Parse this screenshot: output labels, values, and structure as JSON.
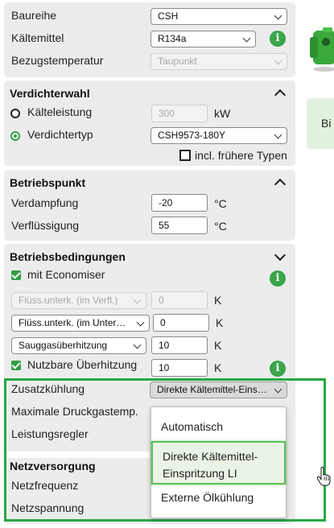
{
  "top": {
    "baureihe": {
      "label": "Baureihe",
      "value": "CSH"
    },
    "kaeltemittel": {
      "label": "Kältemittel",
      "value": "R134a"
    },
    "bezugstemperatur": {
      "label": "Bezugstemperatur",
      "value": "Taupunkt"
    }
  },
  "verdichterwahl": {
    "title": "Verdichterwahl",
    "kaelteleistung": {
      "label": "Kälteleistung",
      "value": "300",
      "unit": "kW"
    },
    "verdichtertyp": {
      "label": "Verdichtertyp",
      "value": "CSH9573-180Y"
    },
    "fruehere_typen": "incl. frühere Typen"
  },
  "betriebspunkt": {
    "title": "Betriebspunkt",
    "verdampfung": {
      "label": "Verdampfung",
      "value": "-20",
      "unit": "°C"
    },
    "verfluessigung": {
      "label": "Verflüssigung",
      "value": "55",
      "unit": "°C"
    }
  },
  "betriebsbedingungen": {
    "title": "Betriebsbedingungen",
    "economiser": "mit Economiser",
    "fluess_verfl": {
      "select": "Flüss.unterk. (im Verfl.)",
      "value": "0",
      "unit": "K"
    },
    "fluess_unter": {
      "select": "Flüss.unterk. (im Unter…",
      "value": "0",
      "unit": "K"
    },
    "sauggas": {
      "select": "Sauggasüberhitzung",
      "value": "10",
      "unit": "K"
    },
    "nutzbare": {
      "label": "Nutzbare Überhitzung",
      "value": "10",
      "unit": "K"
    },
    "zusatzkuehlung": {
      "label": "Zusatzkühlung",
      "value": "Direkte Kältemittel-Eins…"
    },
    "max_druckgastemp": "Maximale Druckgastemp.",
    "leistungsregler": "Leistungsregler"
  },
  "netzversorgung": {
    "title": "Netzversorgung",
    "netzfrequenz": "Netzfrequenz",
    "netzspannung": "Netzspannung"
  },
  "dropdown": {
    "options": [
      "Automatisch",
      "Direkte Kältemittel-Einspritzung LI",
      "Externe Ölkühlung"
    ],
    "option2_line1": "Direkte Kältemittel-",
    "option2_line2": "Einspritzung LI",
    "highlighted_index": 1
  },
  "right": {
    "card_text": "Bi"
  },
  "colors": {
    "accent": "#2e9e45",
    "highlight_border": "#27a844",
    "panel": "#ececec"
  }
}
